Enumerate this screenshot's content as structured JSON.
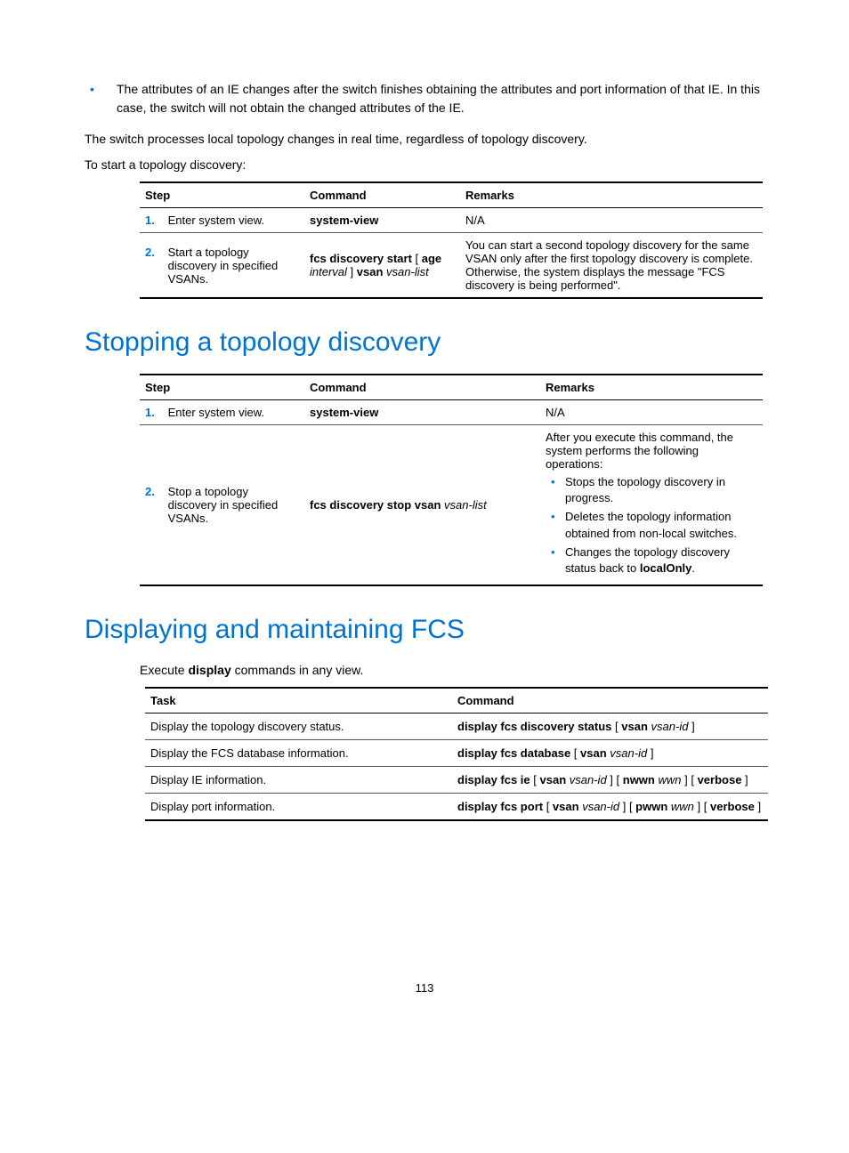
{
  "intro": {
    "bullet1": "The attributes of an IE changes after the switch finishes obtaining the attributes and port information of that IE. In this case, the switch will not obtain the changed attributes of the IE.",
    "para1": "The switch processes local topology changes in real time, regardless of topology discovery.",
    "para2": "To start a topology discovery:"
  },
  "table1": {
    "headers": {
      "step": "Step",
      "command": "Command",
      "remarks": "Remarks"
    },
    "rows": [
      {
        "num": "1.",
        "desc": "Enter system view.",
        "command_html": "<span class='bold'>system-view</span>",
        "remarks_html": "N/A"
      },
      {
        "num": "2.",
        "desc": "Start a topology discovery in specified VSANs.",
        "command_html": "<span class='bold'>fcs discovery start</span> [ <span class='bold'>age</span> <span class='italic'>interval</span> ] <span class='bold'>vsan</span> <span class='italic'>vsan-list</span>",
        "remarks_html": "You can start a second topology discovery for the same VSAN only after the first topology discovery is complete. Otherwise, the system displays the message \"FCS discovery is being performed\"."
      }
    ]
  },
  "h1_stop": "Stopping a topology discovery",
  "table2": {
    "headers": {
      "step": "Step",
      "command": "Command",
      "remarks": "Remarks"
    },
    "rows": [
      {
        "num": "1.",
        "desc": "Enter system view.",
        "command_html": "<span class='bold'>system-view</span>",
        "remarks_html": "N/A"
      },
      {
        "num": "2.",
        "desc": "Stop a topology discovery in specified VSANs.",
        "command_html": "<span class='bold'>fcs discovery stop vsan</span> <span class='italic'>vsan-list</span>",
        "remarks_intro": "After you execute this command, the system performs the following operations:",
        "remarks_items": [
          "Stops the topology discovery in progress.",
          "Deletes the topology information obtained from non-local switches.",
          "Changes the topology discovery status back to <span class='bold'>localOnly</span>."
        ]
      }
    ]
  },
  "h1_display": "Displaying and maintaining FCS",
  "display_intro_html": "Execute <span class='bold'>display</span> commands in any view.",
  "table3": {
    "headers": {
      "task": "Task",
      "command": "Command"
    },
    "rows": [
      {
        "task": "Display the topology discovery status.",
        "command_html": "<span class='bold'>display fcs discovery status</span> [ <span class='bold'>vsan</span> <span class='italic'>vsan-id</span> ]"
      },
      {
        "task": "Display the FCS database information.",
        "command_html": "<span class='bold'>display fcs database</span> [ <span class='bold'>vsan</span> <span class='italic'>vsan-id</span> ]"
      },
      {
        "task": "Display IE information.",
        "command_html": "<span class='bold'>display fcs ie</span> [ <span class='bold'>vsan</span> <span class='italic'>vsan-id</span> ] [ <span class='bold'>nwwn</span> <span class='italic'>wwn</span> ] [ <span class='bold'>verbose</span> ]"
      },
      {
        "task": "Display port information.",
        "command_html": "<span class='bold'>display fcs port</span> [ <span class='bold'>vsan</span> <span class='italic'>vsan-id</span> ] [ <span class='bold'>pwwn</span> <span class='italic'>wwn</span> ] [ <span class='bold'>verbose</span> ]"
      }
    ]
  },
  "page_number": "113"
}
